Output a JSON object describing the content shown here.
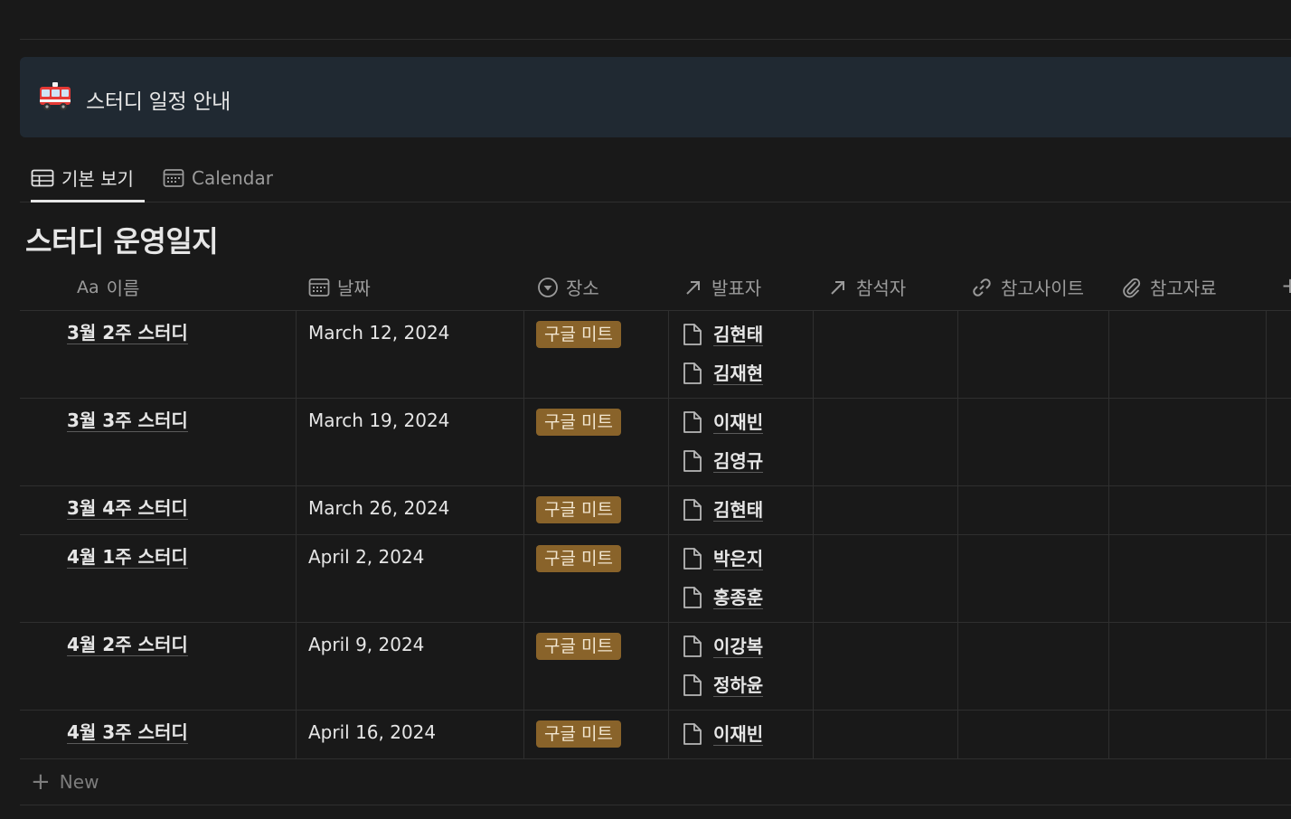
{
  "callout": {
    "emoji": "fire-engine",
    "text": "스터디 일정 안내"
  },
  "tabs": [
    {
      "label": "기본 보기",
      "icon": "table-icon",
      "active": true
    },
    {
      "label": "Calendar",
      "icon": "calendar-icon",
      "active": false
    }
  ],
  "database": {
    "title": "스터디 운영일지",
    "columns": [
      {
        "label": "이름",
        "prefix": "Aa"
      },
      {
        "label": "날짜",
        "icon": "calendar-icon"
      },
      {
        "label": "장소",
        "icon": "select-icon"
      },
      {
        "label": "발표자",
        "icon": "relation-arrow-icon"
      },
      {
        "label": "참석자",
        "icon": "relation-arrow-icon"
      },
      {
        "label": "참고사이트",
        "icon": "link-icon"
      },
      {
        "label": "참고자료",
        "icon": "paperclip-icon"
      }
    ],
    "add_column": "+",
    "rows": [
      {
        "name": "3월 2주 스터디",
        "date": "March 12, 2024",
        "place": "구글 미트",
        "presenters": [
          "김현태",
          "김재현"
        ]
      },
      {
        "name": "3월 3주 스터디",
        "date": "March 19, 2024",
        "place": "구글 미트",
        "presenters": [
          "이재빈",
          "김영규"
        ]
      },
      {
        "name": "3월 4주 스터디",
        "date": "March 26, 2024",
        "place": "구글 미트",
        "presenters": [
          "김현태"
        ]
      },
      {
        "name": "4월 1주 스터디",
        "date": "April 2, 2024",
        "place": "구글 미트",
        "presenters": [
          "박은지",
          "홍종훈"
        ]
      },
      {
        "name": "4월 2주 스터디",
        "date": "April 9, 2024",
        "place": "구글 미트",
        "presenters": [
          "이강복",
          "정하윤"
        ]
      },
      {
        "name": "4월 3주 스터디",
        "date": "April 16, 2024",
        "place": "구글 미트",
        "presenters": [
          "이재빈"
        ]
      }
    ],
    "new_label": "New"
  },
  "colors": {
    "background": "#191919",
    "callout_bg": "#202932",
    "tag_bg": "#89632a",
    "border": "#2f2f2f"
  }
}
